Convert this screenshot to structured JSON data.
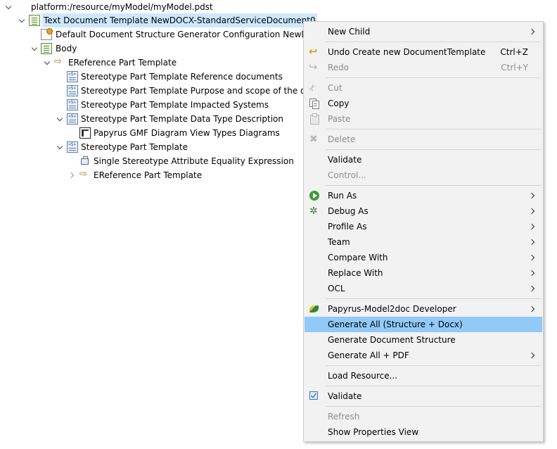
{
  "tree": {
    "root": {
      "label": "platform:/resource/myModel/myModel.pdst",
      "icon": "collapse-chevron-icon"
    },
    "items": [
      {
        "label": "Text Document Template NewDOCX-StandardServiceDocument0",
        "icon": "docx-template-icon",
        "expanded": true,
        "selected": true
      },
      {
        "label": "Default Document Structure Generator Configuration NewDOC",
        "icon": "generator-configuration-icon"
      },
      {
        "label": "Body",
        "icon": "body-icon",
        "expanded": true
      },
      {
        "label": "EReference Part Template",
        "icon": "ereference-icon",
        "expanded": true
      },
      {
        "label": "Stereotype Part Template Reference documents",
        "icon": "stereotype-part-icon"
      },
      {
        "label": "Stereotype Part Template Purpose and scope of the d",
        "icon": "stereotype-part-icon"
      },
      {
        "label": "Stereotype Part Template Impacted Systems",
        "icon": "stereotype-part-icon"
      },
      {
        "label": "Stereotype Part Template Data Type Description",
        "icon": "stereotype-part-icon",
        "expanded": true
      },
      {
        "label": "Papyrus GMF Diagram View Types Diagrams",
        "icon": "diagram-icon"
      },
      {
        "label": "Stereotype Part Template",
        "icon": "stereotype-part-icon",
        "expanded": true
      },
      {
        "label": "Single Stereotype Attribute Equality Expression",
        "icon": "equality-expression-icon"
      },
      {
        "label": "EReference Part Template",
        "icon": "ereference-icon",
        "expanded": false
      }
    ]
  },
  "menu": {
    "new_child": "New Child",
    "undo": "Undo Create new DocumentTemplate",
    "undo_shortcut": "Ctrl+Z",
    "redo": "Redo",
    "redo_shortcut": "Ctrl+Y",
    "cut": "Cut",
    "copy": "Copy",
    "paste": "Paste",
    "delete": "Delete",
    "validate": "Validate",
    "control": "Control...",
    "run_as": "Run As",
    "debug_as": "Debug As",
    "profile_as": "Profile As",
    "team": "Team",
    "compare_with": "Compare With",
    "replace_with": "Replace With",
    "ocl": "OCL",
    "papyrus_dev": "Papyrus-Model2doc Developer",
    "generate_all": "Generate All (Structure + Docx)",
    "generate_structure": "Generate Document Structure",
    "generate_pdf": "Generate All + PDF",
    "load_resource": "Load Resource...",
    "validate_check": "Validate",
    "refresh": "Refresh",
    "show_properties": "Show Properties View"
  },
  "colors": {
    "selection": "#cce8ff",
    "menu_highlight": "#91c9f7",
    "menu_background": "#f2f2f2",
    "disabled_text": "#8d8d8d"
  }
}
